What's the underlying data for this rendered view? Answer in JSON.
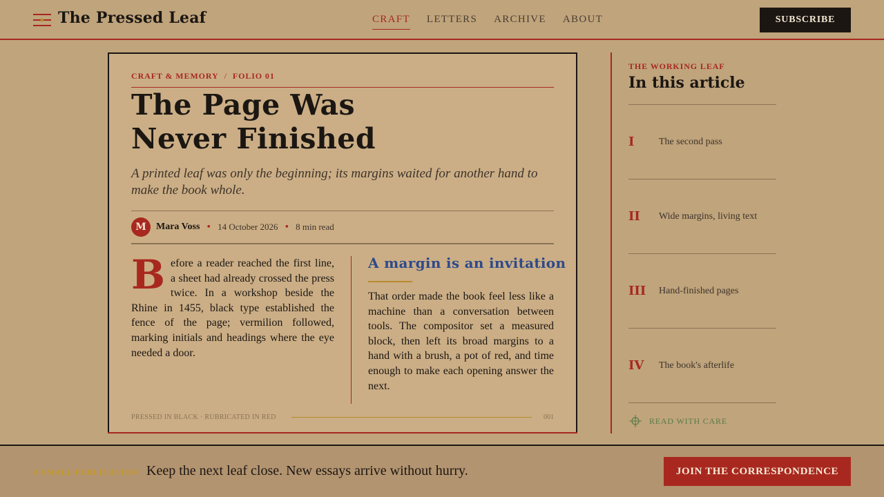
{
  "header": {
    "logo": "The Pressed Leaf",
    "nav": [
      {
        "label": "CRAFT"
      },
      {
        "label": "LETTERS"
      },
      {
        "label": "ARCHIVE"
      },
      {
        "label": "ABOUT"
      }
    ],
    "active_nav": "CRAFT",
    "subscribe_label": "SUBSCRIBE"
  },
  "article": {
    "category": "CRAFT & MEMORY",
    "separator": "/",
    "folio_label": "FOLIO 01",
    "title": "The Page Was Never Finished",
    "dek": "A printed leaf was only the beginning; its margins waited for another hand to make the book whole.",
    "avatar_letter": "M",
    "author": "Mara Voss",
    "date": "14 October 2026",
    "read_time": "8 min read",
    "dropcap": "B",
    "left_text": "efore a reader reached the first line, a sheet had already crossed the press twice. In a workshop beside the Rhine in 1455, black type established the fence of the page; vermilion followed, marking initials and headings where the eye needed a door.",
    "right_heading": "A margin is an invitation",
    "right_text": "That order made the book feel less like a machine than a conversation between tools. The compositor set a measured block, then left its broad margins to a hand with a brush, a pot of red, and time enough to make each opening answer the next.",
    "footnote": "PRESSED IN BLACK · RUBRICATED IN RED",
    "page_number": "001"
  },
  "sidebar": {
    "kicker": "THE WORKING LEAF",
    "title": "In this article",
    "toc": [
      {
        "num": "I",
        "label": "The second pass"
      },
      {
        "num": "II",
        "label": "Wide margins, living text"
      },
      {
        "num": "III",
        "label": "Hand-finished pages"
      },
      {
        "num": "IV",
        "label": "The book's afterlife"
      }
    ],
    "read_care": "READ WITH CARE"
  },
  "footer": {
    "kicker": "A SMALL PUBLICATION",
    "line": "Keep the next leaf close. New essays arrive without hurry.",
    "join_label": "JOIN THE CORRESPONDENCE"
  },
  "colors": {
    "background": "#bfa47c",
    "card": "#cbae86",
    "rubric_red": "#a8281f",
    "ink": "#1b1612",
    "blue_heading": "#2f4a8a",
    "gold": "#b88a2a",
    "green": "#5a7a4a"
  }
}
